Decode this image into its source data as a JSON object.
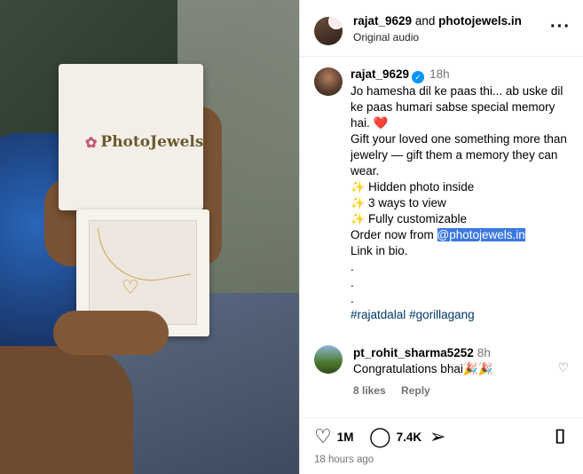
{
  "photo": {
    "brand_logo": "PhotoJewels"
  },
  "header": {
    "user": "rajat_9629",
    "and_text": "and",
    "collab": "photojewels.in",
    "audio": "Original audio",
    "more_icon": "more-horizontal-icon"
  },
  "caption": {
    "user": "rajat_9629",
    "time": "18h",
    "line1": "Jo hamesha dil ke paas thi... ab uske dil ke paas humari sabse special memory hai.",
    "line2": "Gift your loved one something more than jewelry — gift them a memory they can wear.",
    "feature1": "Hidden photo inside",
    "feature2": "3 ways to view",
    "feature3": "Fully customizable",
    "order_prefix": "Order now from",
    "order_handle": "@photojewels.in",
    "bio": "Link in bio.",
    "dot": ".",
    "tag1": "#rajatdalal",
    "tag2": "#gorillagang"
  },
  "comment": {
    "user": "pt_rohit_sharma5252",
    "time": "8h",
    "text": "Congratulations bhai",
    "likes": "8 likes",
    "reply": "Reply"
  },
  "actions": {
    "likes": "1M",
    "comments": "7.4K",
    "posted": "18 hours ago"
  },
  "colors": {
    "verified": "#0095f6",
    "link": "#00376b",
    "highlight": "#3b78e0",
    "muted": "#737373"
  }
}
